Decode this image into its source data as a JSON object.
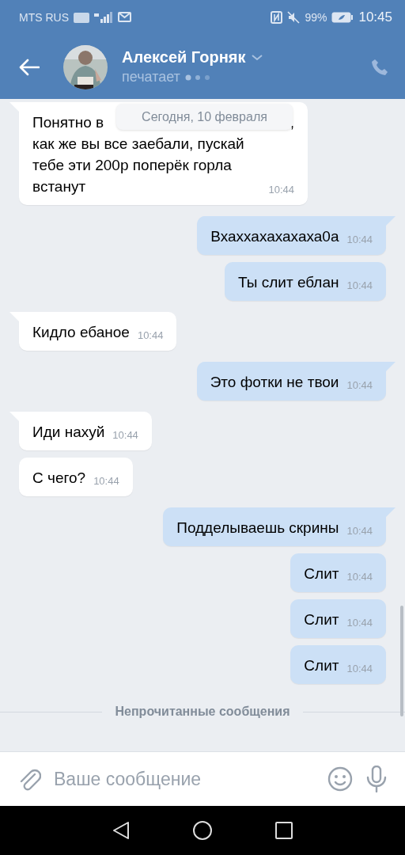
{
  "status_bar": {
    "carrier": "MTS RUS",
    "battery": "99%",
    "time": "10:45"
  },
  "header": {
    "name": "Алексей Горняк",
    "status": "печатает"
  },
  "date_chip": "Сегодня, 10 февраля",
  "messages": [
    {
      "kind": "incoming",
      "tail": true,
      "lines": [
        [
          "Понятно в",
          ","
        ],
        [
          "как же вы все заебали, пускай"
        ],
        [
          "тебе эти 200р поперёк горла"
        ],
        [
          "встанут"
        ]
      ],
      "time": "10:44"
    },
    {
      "kind": "outgoing",
      "tail": true,
      "lines": [
        [
          "Вхаххахахахаха0а"
        ]
      ],
      "time": "10:44"
    },
    {
      "kind": "outgoing",
      "tail": false,
      "lines": [
        [
          "Ты слит еблан"
        ]
      ],
      "time": "10:44"
    },
    {
      "kind": "incoming",
      "tail": true,
      "lines": [
        [
          "Кидло ебаное"
        ]
      ],
      "time": "10:44"
    },
    {
      "kind": "outgoing",
      "tail": true,
      "lines": [
        [
          "Это фотки не твои"
        ]
      ],
      "time": "10:44"
    },
    {
      "kind": "incoming",
      "tail": true,
      "lines": [
        [
          "Иди нахуй"
        ]
      ],
      "time": "10:44"
    },
    {
      "kind": "incoming",
      "tail": false,
      "lines": [
        [
          "С чего?"
        ]
      ],
      "time": "10:44"
    },
    {
      "kind": "outgoing",
      "tail": true,
      "lines": [
        [
          "Подделываешь скрины"
        ]
      ],
      "time": "10:44"
    },
    {
      "kind": "outgoing",
      "tail": false,
      "lines": [
        [
          "Слит"
        ]
      ],
      "time": "10:44"
    },
    {
      "kind": "outgoing",
      "tail": false,
      "lines": [
        [
          "Слит"
        ]
      ],
      "time": "10:44"
    },
    {
      "kind": "outgoing",
      "tail": false,
      "lines": [
        [
          "Слит"
        ]
      ],
      "time": "10:44"
    }
  ],
  "unread_divider": "Непрочитанные сообщения",
  "composer": {
    "placeholder": "Ваше сообщение"
  }
}
